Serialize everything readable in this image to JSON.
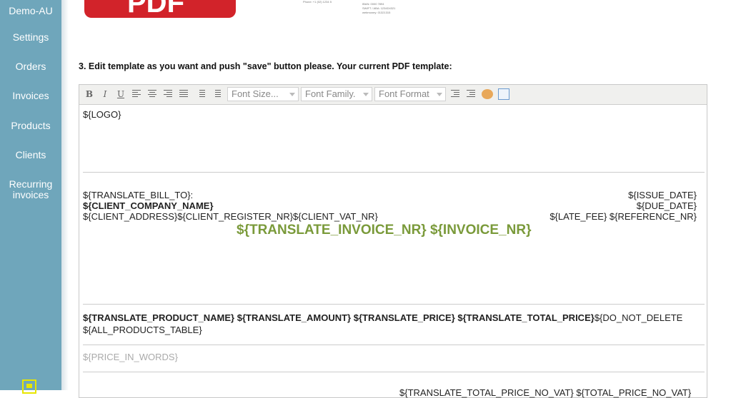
{
  "sidebar": {
    "items": [
      {
        "label": "Demo-AU"
      },
      {
        "label": "Settings"
      },
      {
        "label": "Orders"
      },
      {
        "label": "Invoices"
      },
      {
        "label": "Products"
      },
      {
        "label": "Clients"
      },
      {
        "label": "Recurring"
      },
      {
        "label": "invoices"
      }
    ]
  },
  "header": {
    "logo_text": "PDF",
    "thumb_lines": [
      "Phone: +1 (02) 1234 5",
      "IBAN: 0000 7894",
      "SWIFT / ABA: 1234D4321",
      "webmoney: 01321315"
    ]
  },
  "instruction": "3. Edit template as you want and push \"save\" button please. Your current PDF template:",
  "toolbar": {
    "bold": "B",
    "italic": "I",
    "underline": "U",
    "font_size": "Font Size...",
    "font_family": "Font Family.",
    "font_format": "Font Format"
  },
  "template": {
    "logo": "${LOGO}",
    "bill_to": "${TRANSLATE_BILL_TO}:",
    "company": "${CLIENT_COMPANY_NAME}",
    "address": "${CLIENT_ADDRESS}${CLIENT_REGISTER_NR}${CLIENT_VAT_NR}",
    "issue_date": "${ISSUE_DATE}",
    "due_date": "${DUE_DATE}",
    "late_fee": "${LATE_FEE} ${REFERENCE_NR}",
    "invoice_nr": "${TRANSLATE_INVOICE_NR} ${INVOICE_NR}",
    "product_header": "${TRANSLATE_PRODUCT_NAME} ${TRANSLATE_AMOUNT} ${TRANSLATE_PRICE} ${TRANSLATE_TOTAL_PRICE}",
    "do_not_delete": "${DO_NOT_DELETE",
    "products_table": "${ALL_PRODUCTS_TABLE}",
    "price_in_words": "${PRICE_IN_WORDS}",
    "totals_partial": "${TRANSLATE_TOTAL_PRICE_NO_VAT} ${TOTAL_PRICE_NO_VAT}"
  },
  "colors": {
    "sidebar": "#6fa6bb",
    "accent_green": "#7a9a3a",
    "logo_red": "#d2232a"
  }
}
